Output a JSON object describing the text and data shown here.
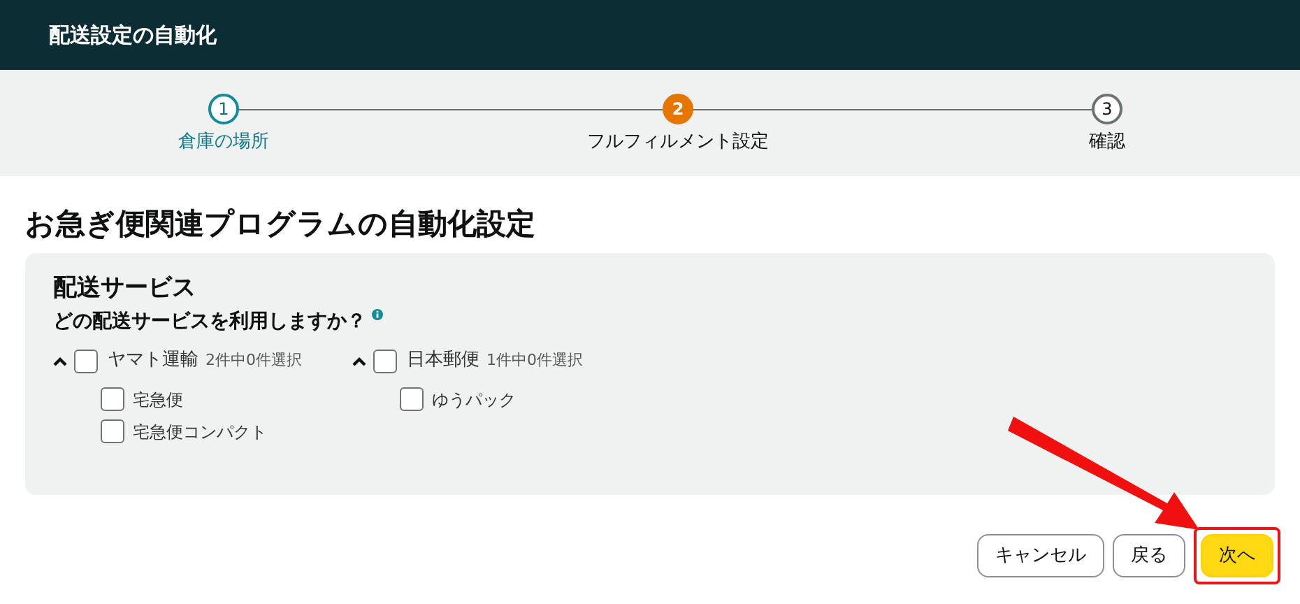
{
  "header": {
    "title": "配送設定の自動化"
  },
  "steps": [
    {
      "number": "1",
      "label": "倉庫の場所",
      "completed": true,
      "selected": false
    },
    {
      "number": "2",
      "label": "フルフィルメント設定",
      "completed": false,
      "selected": true
    },
    {
      "number": "3",
      "label": "確認",
      "completed": false,
      "selected": false
    }
  ],
  "page_title": "お急ぎ便関連プログラムの自動化設定",
  "card": {
    "title": "配送サービス",
    "question": "どの配送サービスを利用しますか？",
    "carriers": [
      {
        "name": "ヤマト運輸",
        "count": "2件中0件選択",
        "expanded": true,
        "checked": false,
        "services": [
          {
            "name": "宅急便",
            "checked": false
          },
          {
            "name": "宅急便コンパクト",
            "checked": false
          }
        ]
      },
      {
        "name": "日本郵便",
        "count": "1件中0件選択",
        "expanded": true,
        "checked": false,
        "services": [
          {
            "name": "ゆうパック",
            "checked": false
          }
        ]
      }
    ]
  },
  "buttons": [
    {
      "label": "キャンセル",
      "kind": "secondary"
    },
    {
      "label": "戻る",
      "kind": "secondary"
    },
    {
      "label": "次へ",
      "kind": "primary"
    }
  ],
  "annotation": {
    "highlight_next": true
  }
}
